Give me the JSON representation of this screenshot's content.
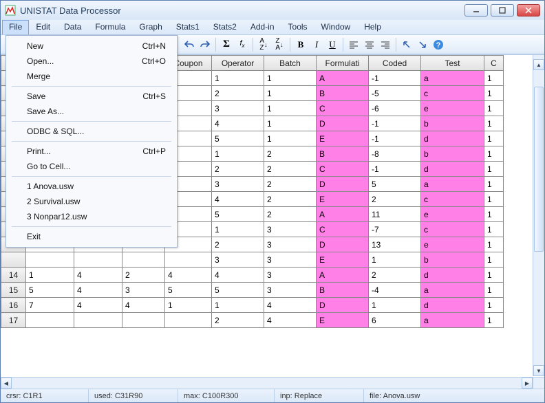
{
  "title": "UNISTAT Data Processor",
  "menubar": [
    "File",
    "Edit",
    "Data",
    "Formula",
    "Graph",
    "Stats1",
    "Stats2",
    "Add-in",
    "Tools",
    "Window",
    "Help"
  ],
  "file_menu": [
    {
      "label": "New",
      "accel": "Ctrl+N"
    },
    {
      "label": "Open...",
      "accel": "Ctrl+O"
    },
    {
      "label": "Merge",
      "accel": ""
    },
    {
      "sep": true
    },
    {
      "label": "Save",
      "accel": "Ctrl+S"
    },
    {
      "label": "Save As...",
      "accel": ""
    },
    {
      "sep": true
    },
    {
      "label": "ODBC & SQL...",
      "accel": ""
    },
    {
      "sep": true
    },
    {
      "label": "Print...",
      "accel": "Ctrl+P"
    },
    {
      "label": "Go to Cell...",
      "accel": ""
    },
    {
      "sep": true
    },
    {
      "label": "1 Anova.usw",
      "accel": ""
    },
    {
      "label": "2 Survival.usw",
      "accel": ""
    },
    {
      "label": "3 Nonpar12.usw",
      "accel": ""
    },
    {
      "sep": true
    },
    {
      "label": "Exit",
      "accel": ""
    }
  ],
  "columns": [
    "",
    "",
    "",
    "Coupon",
    "Operator",
    "Batch",
    "Formulati",
    "Coded",
    "Test",
    "C"
  ],
  "rows": [
    {
      "n": "",
      "a": "",
      "b": "",
      "c": "",
      "coupon": "",
      "op": "1",
      "batch": "1",
      "form": "A",
      "coded": "-1",
      "test": "a",
      "last": "1"
    },
    {
      "n": "",
      "a": "",
      "b": "",
      "c": "",
      "coupon": "",
      "op": "2",
      "batch": "1",
      "form": "B",
      "coded": "-5",
      "test": "c",
      "last": "1"
    },
    {
      "n": "",
      "a": "",
      "b": "",
      "c": "",
      "coupon": "",
      "op": "3",
      "batch": "1",
      "form": "C",
      "coded": "-6",
      "test": "e",
      "last": "1"
    },
    {
      "n": "",
      "a": "",
      "b": "",
      "c": "",
      "coupon": "",
      "op": "4",
      "batch": "1",
      "form": "D",
      "coded": "-1",
      "test": "b",
      "last": "1"
    },
    {
      "n": "",
      "a": "",
      "b": "",
      "c": "",
      "coupon": "",
      "op": "5",
      "batch": "1",
      "form": "E",
      "coded": "-1",
      "test": "d",
      "last": "1"
    },
    {
      "n": "",
      "a": "",
      "b": "",
      "c": "",
      "coupon": "",
      "op": "1",
      "batch": "2",
      "form": "B",
      "coded": "-8",
      "test": "b",
      "last": "1"
    },
    {
      "n": "",
      "a": "",
      "b": "",
      "c": "",
      "coupon": "",
      "op": "2",
      "batch": "2",
      "form": "C",
      "coded": "-1",
      "test": "d",
      "last": "1"
    },
    {
      "n": "",
      "a": "",
      "b": "",
      "c": "",
      "coupon": "",
      "op": "3",
      "batch": "2",
      "form": "D",
      "coded": "5",
      "test": "a",
      "last": "1"
    },
    {
      "n": "",
      "a": "",
      "b": "",
      "c": "",
      "coupon": "",
      "op": "4",
      "batch": "2",
      "form": "E",
      "coded": "2",
      "test": "c",
      "last": "1"
    },
    {
      "n": "",
      "a": "",
      "b": "",
      "c": "",
      "coupon": "",
      "op": "5",
      "batch": "2",
      "form": "A",
      "coded": "11",
      "test": "e",
      "last": "1"
    },
    {
      "n": "",
      "a": "",
      "b": "",
      "c": "",
      "coupon": "",
      "op": "1",
      "batch": "3",
      "form": "C",
      "coded": "-7",
      "test": "c",
      "last": "1"
    },
    {
      "n": "",
      "a": "",
      "b": "",
      "c": "",
      "coupon": "",
      "op": "2",
      "batch": "3",
      "form": "D",
      "coded": "13",
      "test": "e",
      "last": "1"
    },
    {
      "n": "",
      "a": "",
      "b": "",
      "c": "",
      "coupon": "",
      "op": "3",
      "batch": "3",
      "form": "E",
      "coded": "1",
      "test": "b",
      "last": "1"
    },
    {
      "n": "14",
      "a": "1",
      "b": "4",
      "c": "2",
      "coupon": "4",
      "op": "4",
      "batch": "3",
      "form": "A",
      "coded": "2",
      "test": "d",
      "last": "1"
    },
    {
      "n": "15",
      "a": "5",
      "b": "4",
      "c": "3",
      "coupon": "5",
      "op": "5",
      "batch": "3",
      "form": "B",
      "coded": "-4",
      "test": "a",
      "last": "1"
    },
    {
      "n": "16",
      "a": "7",
      "b": "4",
      "c": "4",
      "coupon": "1",
      "op": "1",
      "batch": "4",
      "form": "D",
      "coded": "1",
      "test": "d",
      "last": "1"
    },
    {
      "n": "17",
      "a": "",
      "b": "",
      "c": "",
      "coupon": "",
      "op": "2",
      "batch": "4",
      "form": "E",
      "coded": "6",
      "test": "a",
      "last": "1"
    }
  ],
  "status": {
    "crsr": "crsr: C1R1",
    "used": "used: C31R90",
    "max": "max: C100R300",
    "inp": "inp: Replace",
    "file": "file: Anova.usw"
  }
}
